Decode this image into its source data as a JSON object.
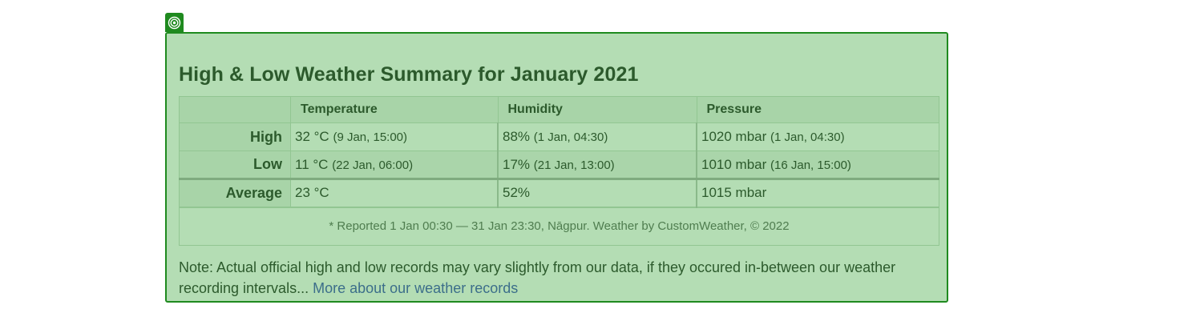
{
  "widget": {
    "badge_icon": "target-icon",
    "accent_color": "#1f8a1f",
    "background_color": "#b4ddb4"
  },
  "title": "High & Low Weather Summary for January 2021",
  "table": {
    "columns": [
      "Temperature",
      "Humidity",
      "Pressure"
    ],
    "rows": [
      {
        "label": "High",
        "temperature": {
          "value": "32 °C",
          "when": "(9 Jan, 15:00)"
        },
        "humidity": {
          "value": "88%",
          "when": "(1 Jan, 04:30)"
        },
        "pressure": {
          "value": "1020 mbar",
          "when": "(1 Jan, 04:30)"
        }
      },
      {
        "label": "Low",
        "temperature": {
          "value": "11 °C",
          "when": "(22 Jan, 06:00)"
        },
        "humidity": {
          "value": "17%",
          "when": "(21 Jan, 13:00)"
        },
        "pressure": {
          "value": "1010 mbar",
          "when": "(16 Jan, 15:00)"
        }
      },
      {
        "label": "Average",
        "temperature": {
          "value": "23 °C"
        },
        "humidity": {
          "value": "52%"
        },
        "pressure": {
          "value": "1015 mbar"
        }
      }
    ],
    "footer": "* Reported 1 Jan 00:30 — 31 Jan 23:30, Nāgpur. Weather by CustomWeather, © 2022"
  },
  "note": {
    "text": "Note: Actual official high and low records may vary slightly from our data, if they occured in-between our weather recording intervals...",
    "link_text": "More about our weather records"
  }
}
